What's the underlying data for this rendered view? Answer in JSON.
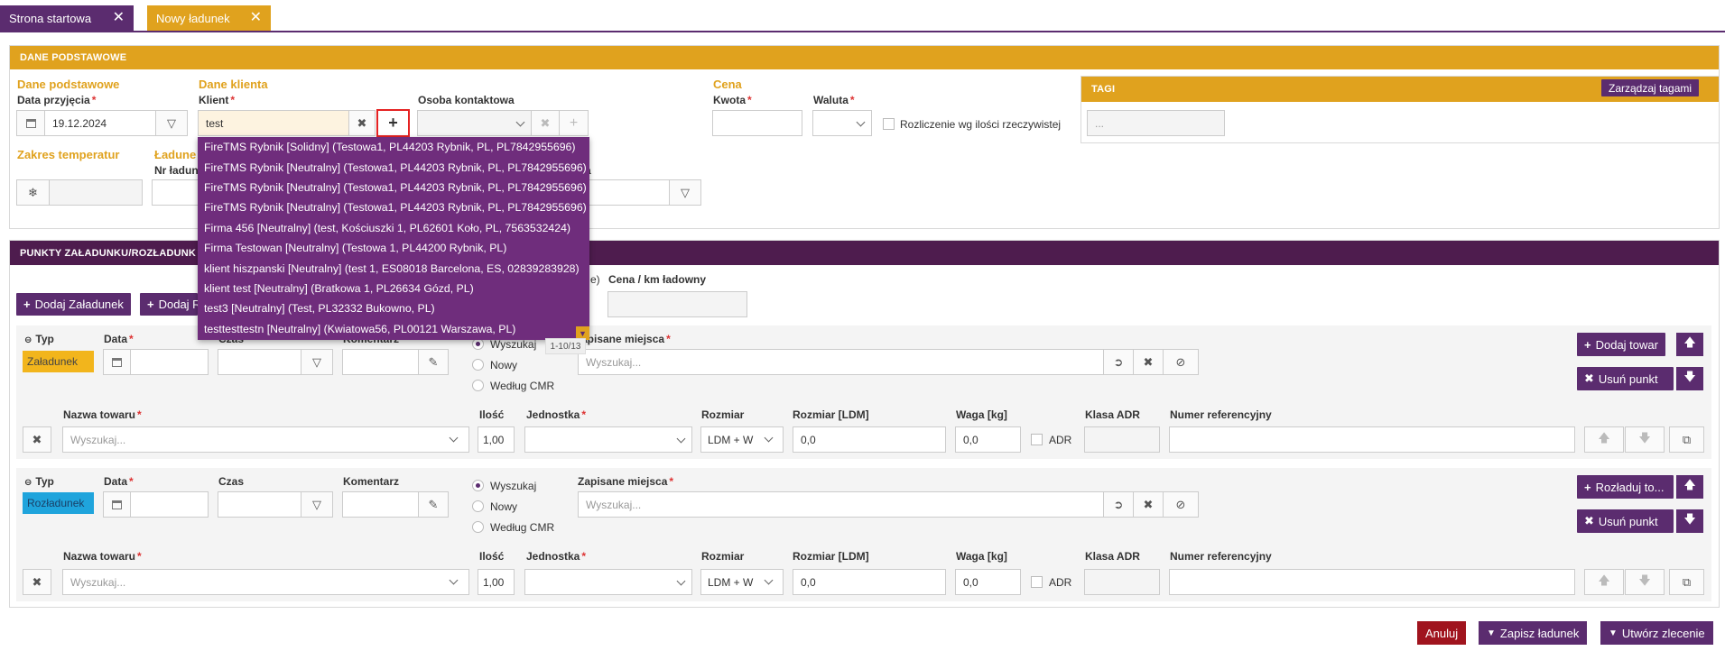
{
  "tabs": [
    {
      "label": "Strona startowa",
      "color": "#5b2c6f"
    },
    {
      "label": "Nowy ładunek",
      "color": "#e0a21e"
    }
  ],
  "colors": {
    "primary": "#5b2c6f",
    "accent": "#e0a21e",
    "danger": "#a0141e",
    "loading_badge": "#f2b51c",
    "unloading_badge": "#1fa4dc"
  },
  "basic": {
    "header": "DANE PODSTAWOWE",
    "section_basic": "Dane podstawowe",
    "date_label": "Data przyjęcia",
    "date_value": "19.12.2024",
    "section_client": "Dane klienta",
    "client_label": "Klient",
    "client_value": "test",
    "contact_label": "Osoba kontaktowa",
    "section_price": "Cena",
    "amount_label": "Kwota",
    "currency_label": "Waluta",
    "settlement_label": "Rozliczenie wg ilości rzeczywistej",
    "section_temp": "Zakres temperatur",
    "section_load": "Ładune",
    "load_no_label": "Nr ładun",
    "partial_label": "a",
    "tags_title": "TAGI",
    "tags_manage": "Zarządzaj tagami",
    "tags_placeholder": "..."
  },
  "dropdown": {
    "items": [
      "FireTMS Rybnik [Solidny] (Testowa1, PL44203 Rybnik, PL, PL7842955696)",
      "FireTMS Rybnik [Neutralny] (Testowa1, PL44203 Rybnik, PL, PL7842955696)",
      "FireTMS Rybnik [Neutralny] (Testowa1, PL44203 Rybnik, PL, PL7842955696)",
      "FireTMS Rybnik [Neutralny] (Testowa1, PL44203 Rybnik, PL, PL7842955696)",
      "Firma 456 [Neutralny] (test, Kościuszki 1, PL62601 Koło, PL, 7563532424)",
      "Firma Testowan [Neutralny] (Testowa 1, PL44200 Rybnik, PL)",
      "klient hiszpanski [Neutralny] (test 1, ES08018 Barcelona, ES, 02839283928)",
      "klient test [Neutralny] (Bratkowa 1, PL26634 Gózd, PL)",
      "test3 [Neutralny] (Test, PL32332 Bukowno, PL)",
      "testtesttestn [Neutralny] (Kwiatowa56, PL00121 Warszawa, PL)"
    ],
    "pager": "1-10/13"
  },
  "points": {
    "header": "PUNKTY ZAŁADUNKU/ROZŁADUNK",
    "add_loading": "Dodaj Załadunek",
    "add_unloading_partial": "Dodaj R",
    "partial_label": "e)",
    "price_km_label": "Cena / km ładowny"
  },
  "labels": {
    "type": "Typ",
    "date": "Data",
    "time": "Czas",
    "comment": "Komentarz",
    "search": "Wyszukaj",
    "new": "Nowy",
    "cmr": "Według CMR",
    "saved_places": "Zapisane miejsca",
    "saved_places_partial": "apisane miejsca",
    "search_placeholder": "Wyszukaj...",
    "goods_name": "Nazwa towaru",
    "quantity": "Ilość",
    "unit": "Jednostka",
    "size": "Rozmiar",
    "size_ldm": "Rozmiar [LDM]",
    "weight": "Waga [kg]",
    "adr_class": "Klasa ADR",
    "ref_no": "Numer referencyjny",
    "adr": "ADR"
  },
  "stops": [
    {
      "badge": "Załadunek",
      "add_button": "Dodaj towar",
      "remove_button": "Usuń punkt",
      "quantity": "1,00",
      "size": "LDM + W",
      "ldm": "0,0",
      "weight": "0,0"
    },
    {
      "badge": "Rozładunek",
      "add_button": "Rozładuj to...",
      "remove_button": "Usuń punkt",
      "quantity": "1,00",
      "size": "LDM + W",
      "ldm": "0,0",
      "weight": "0,0"
    }
  ],
  "footer": {
    "cancel": "Anuluj",
    "save": "Zapisz ładunek",
    "create": "Utwórz zlecenie"
  }
}
